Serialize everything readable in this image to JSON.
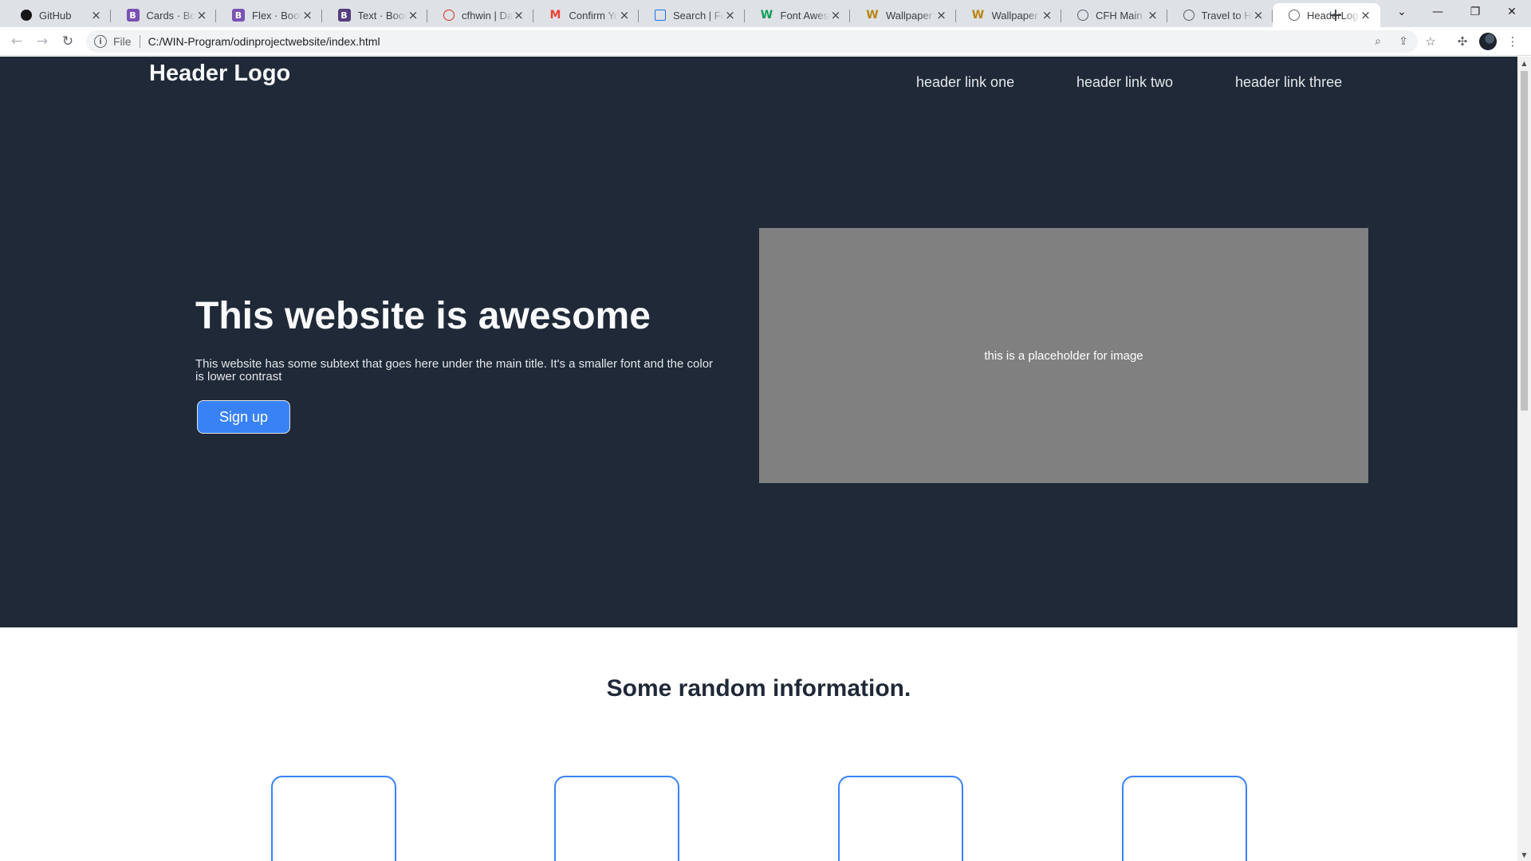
{
  "browser": {
    "tabs": [
      {
        "title": "GitHub",
        "icon": "github-icon",
        "fav_char": "",
        "fav_color": "#181717"
      },
      {
        "title": "Cards · Bootstrap",
        "icon": "bootstrap-icon",
        "fav_char": "B",
        "fav_color": "#7952b3"
      },
      {
        "title": "Flex · Bootstrap",
        "icon": "bootstrap-icon",
        "fav_char": "B",
        "fav_color": "#7952b3"
      },
      {
        "title": "Text · Bootstrap",
        "icon": "bootstrap-icon",
        "fav_char": "B",
        "fav_color": "#563d7c"
      },
      {
        "title": "cfhwin | Dashboard",
        "icon": "dashboard-icon",
        "fav_char": "",
        "fav_color": "#d93025"
      },
      {
        "title": "Confirm Your",
        "icon": "gmail-icon",
        "fav_char": "M",
        "fav_color": "#ea4335"
      },
      {
        "title": "Search | Font",
        "icon": "flag-icon",
        "fav_char": "",
        "fav_color": "#1a73e8"
      },
      {
        "title": "Font Awesome",
        "icon": "wix-icon",
        "fav_char": "W",
        "fav_color": "#0c9d58"
      },
      {
        "title": "Wallpaper Mo",
        "icon": "wix-icon",
        "fav_char": "W",
        "fav_color": "#b8860b"
      },
      {
        "title": "Wallpaper Mo",
        "icon": "wix-icon",
        "fav_char": "W",
        "fav_color": "#b8860b"
      },
      {
        "title": "CFH Main",
        "icon": "globe-icon",
        "fav_char": "",
        "fav_color": "#5f6368"
      },
      {
        "title": "Travel to Hu",
        "icon": "globe-icon",
        "fav_char": "",
        "fav_color": "#5f6368"
      },
      {
        "title": "HeaderLogo",
        "icon": "globe-icon",
        "fav_char": "",
        "fav_color": "#5f6368"
      }
    ],
    "url_scheme": "File",
    "url": "C:/WIN-Program/odinprojectwebsite/index.html"
  },
  "site": {
    "logo": "Header Logo",
    "nav": [
      "header link one",
      "header link two",
      "header link three"
    ],
    "hero": {
      "title": "This website is awesome",
      "subtext": "This website has some subtext that goes here under the main title. It's a smaller font and the color is lower contrast",
      "cta": "Sign up",
      "image_placeholder": "this is a placeholder for image"
    },
    "info_title": "Some random information."
  },
  "colors": {
    "hero_bg": "#1f2937",
    "accent": "#3882f6",
    "placeholder_bg": "#808080"
  }
}
